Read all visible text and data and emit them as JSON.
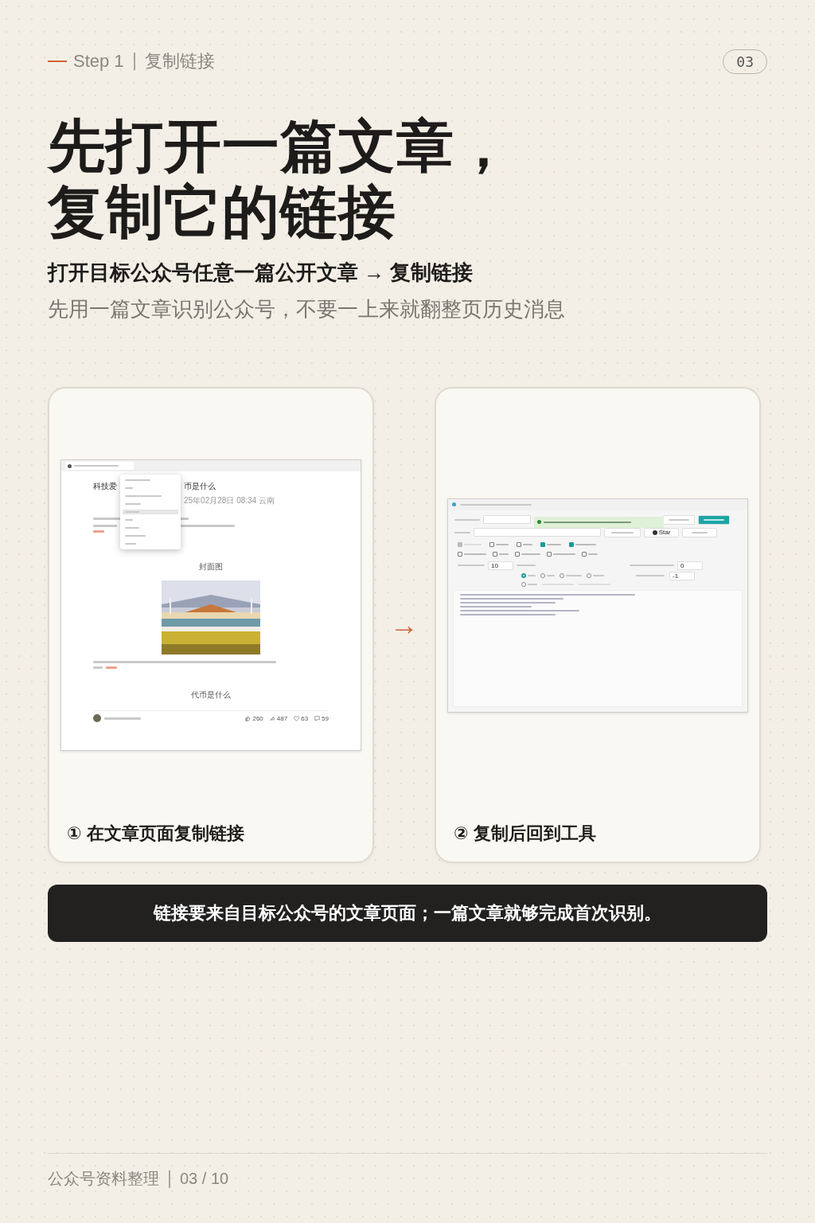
{
  "header": {
    "step": "Step 1",
    "section": "复制链接",
    "page_badge": "03"
  },
  "title_lines": [
    "先打开一篇文章，",
    "复制它的链接"
  ],
  "subtitle": "打开目标公众号任意一篇公开文章 → 复制链接",
  "description": "先用一篇文章识别公众号，不要一上来就翻整页历史消息",
  "cards": [
    {
      "kind": "browser",
      "caption": "① 在文章页面复制链接",
      "title_start": "科技爱",
      "title_end": "币是什么",
      "date": "25年02月28日 08:34 云南",
      "figure_caption": "封面图",
      "section_heading": "代币是什么",
      "stats": [
        "260",
        "487",
        "63",
        "59"
      ]
    },
    {
      "kind": "tool",
      "caption": "② 复制后回到工具",
      "star": "Star",
      "options": [
        {
          "checked": true,
          "disabled": true
        },
        {
          "checked": false,
          "disabled": false
        },
        {
          "checked": false,
          "disabled": false
        },
        {
          "checked": true,
          "disabled": false
        },
        {
          "checked": true,
          "disabled": false
        },
        {
          "checked": false,
          "disabled": false
        },
        {
          "checked": false,
          "disabled": false
        },
        {
          "checked": false,
          "disabled": false
        },
        {
          "checked": false,
          "disabled": false
        },
        {
          "checked": false,
          "disabled": false
        }
      ],
      "radios": [
        {
          "selected": true
        },
        {
          "selected": false
        },
        {
          "selected": false
        },
        {
          "selected": false
        },
        {
          "selected": false
        }
      ],
      "wait_value": "10",
      "count_value": "0",
      "page_value": "-1"
    }
  ],
  "arrow": "→",
  "banner": "链接要来自目标公众号的文章页面；一篇文章就够完成首次识别。",
  "footer": {
    "source": "公众号资料整理",
    "page": "03 / 10"
  }
}
